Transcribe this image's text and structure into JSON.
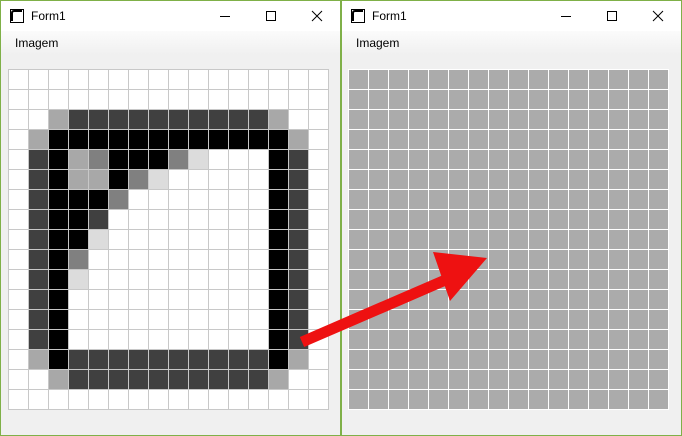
{
  "windows": {
    "left": {
      "title": "Form1",
      "menu": "Imagem"
    },
    "right": {
      "title": "Form1",
      "menu": "Imagem"
    }
  },
  "titlebar_icons": [
    "app-icon",
    "minimize-icon",
    "maximize-icon",
    "close-icon"
  ],
  "colors": {
    "window_border": "#7fb048",
    "grid_line": "#c8c8c8",
    "right_cell": "#ababab",
    "right_grid_line": "#ffffff",
    "arrow": "#ee1111"
  },
  "palette": {
    "W": "#ffffff",
    "K": "#000000",
    "D": "#404040",
    "M": "#5a5a5a",
    "G": "#808080",
    "S": "#a8a8a8",
    "L": "#dcdcdc"
  },
  "left_image_rows": [
    "WWWWWWWWWWWWWWWW",
    "WWWWWWWWWWWWWWWW",
    "WWSDDDDDDDDDDSWW",
    "WSKKKKKKKKKKKKSW",
    "WDKSGKKKGLWWWKDW",
    "WDKSSKGLWWWWWKDW",
    "WDKKKGWWWWWWWKDW",
    "WDKKDWWWWWWWWKDW",
    "WDKKLWWWWWWWWKDW",
    "WDKGWWWWWWWWWKDW",
    "WDKLWWWWWWWWWKDW",
    "WDKWWWWWWWWWWKDW",
    "WDKWWWWWWWWWWKDW",
    "WDKWWWWWWWWWWKDW",
    "WSKDDDDDDDDDDKSW",
    "WWSDDDDDDDDDDSWW",
    "WWWWWWWWWWWWWWWW"
  ]
}
